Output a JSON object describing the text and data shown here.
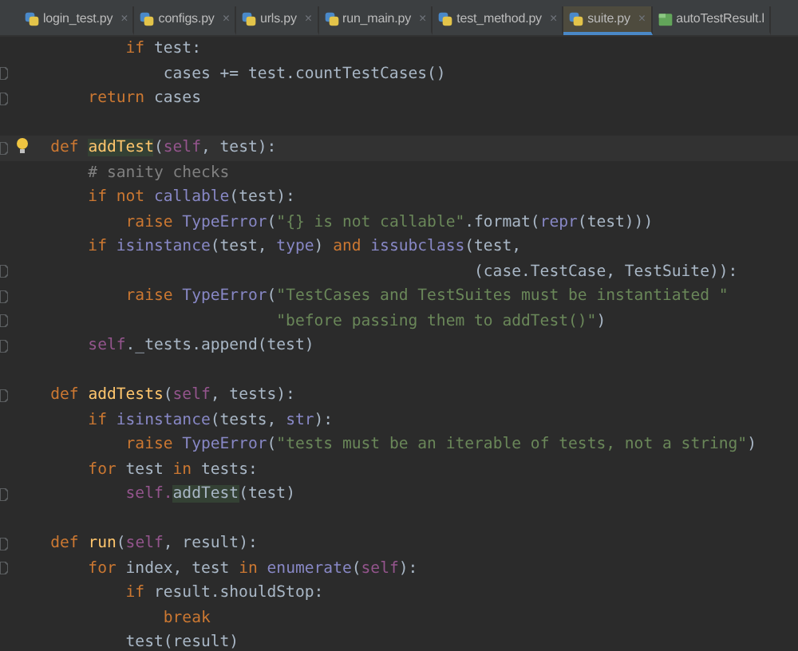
{
  "tabs": [
    {
      "label": "login_test.py",
      "kind": "python",
      "selected": false,
      "close": "×"
    },
    {
      "label": "configs.py",
      "kind": "python",
      "selected": false,
      "close": "×"
    },
    {
      "label": "urls.py",
      "kind": "python",
      "selected": false,
      "close": "×"
    },
    {
      "label": "run_main.py",
      "kind": "python",
      "selected": false,
      "close": "×"
    },
    {
      "label": "test_method.py",
      "kind": "python",
      "selected": false,
      "close": "×"
    },
    {
      "label": "suite.py",
      "kind": "python",
      "selected": true,
      "close": "×"
    },
    {
      "label": "autoTestResult.l",
      "kind": "html",
      "selected": false
    }
  ],
  "editor": {
    "lines": [
      {
        "fold": false,
        "current": false,
        "tokens": [
          {
            "kind": "kw",
            "text": "            if"
          },
          {
            "kind": "plain",
            "text": " test:"
          }
        ]
      },
      {
        "fold": true,
        "current": false,
        "tokens": [
          {
            "kind": "plain",
            "text": "                cases += test.countTestCases()"
          }
        ]
      },
      {
        "fold": true,
        "current": false,
        "tokens": [
          {
            "kind": "kw",
            "text": "        return"
          },
          {
            "kind": "plain",
            "text": " cases"
          }
        ]
      },
      {
        "fold": false,
        "current": false
      },
      {
        "fold": true,
        "current": true,
        "tokens": [
          {
            "kind": "kw",
            "text": "    def "
          },
          {
            "kind": "fnhl",
            "text": "addTest"
          },
          {
            "kind": "plain",
            "text": "("
          },
          {
            "kind": "self",
            "text": "self"
          },
          {
            "kind": "plain",
            "text": ", test):"
          }
        ]
      },
      {
        "fold": false,
        "current": false,
        "tokens": [
          {
            "kind": "cmt",
            "text": "        # sanity checks"
          }
        ]
      },
      {
        "fold": false,
        "current": false,
        "tokens": [
          {
            "kind": "kw",
            "text": "        if not "
          },
          {
            "kind": "builtin",
            "text": "callable"
          },
          {
            "kind": "plain",
            "text": "(test):"
          }
        ]
      },
      {
        "fold": false,
        "current": false,
        "tokens": [
          {
            "kind": "kw",
            "text": "            raise "
          },
          {
            "kind": "builtin",
            "text": "TypeError"
          },
          {
            "kind": "plain",
            "text": "("
          },
          {
            "kind": "str",
            "text": "\"{} is not callable\""
          },
          {
            "kind": "plain",
            "text": ".format("
          },
          {
            "kind": "builtin",
            "text": "repr"
          },
          {
            "kind": "plain",
            "text": "(test)))"
          }
        ]
      },
      {
        "fold": false,
        "current": false,
        "tokens": [
          {
            "kind": "kw",
            "text": "        if "
          },
          {
            "kind": "builtin",
            "text": "isinstance"
          },
          {
            "kind": "plain",
            "text": "(test, "
          },
          {
            "kind": "builtin",
            "text": "type"
          },
          {
            "kind": "plain",
            "text": ") "
          },
          {
            "kind": "kw",
            "text": "and "
          },
          {
            "kind": "builtin",
            "text": "issubclass"
          },
          {
            "kind": "plain",
            "text": "(test,"
          }
        ]
      },
      {
        "fold": true,
        "current": false,
        "tokens": [
          {
            "kind": "plain",
            "text": "                                                 (case.TestCase, TestSuite)):"
          }
        ]
      },
      {
        "fold": true,
        "current": false,
        "tokens": [
          {
            "kind": "kw",
            "text": "            raise "
          },
          {
            "kind": "builtin",
            "text": "TypeError"
          },
          {
            "kind": "plain",
            "text": "("
          },
          {
            "kind": "str",
            "text": "\"TestCases and TestSuites must be instantiated \""
          }
        ]
      },
      {
        "fold": true,
        "current": false,
        "tokens": [
          {
            "kind": "str",
            "text": "                            \"before passing them to addTest()\""
          },
          {
            "kind": "plain",
            "text": ")"
          }
        ]
      },
      {
        "fold": true,
        "current": false,
        "tokens": [
          {
            "kind": "self",
            "text": "        self"
          },
          {
            "kind": "plain",
            "text": "._tests.append(test)"
          }
        ]
      },
      {
        "fold": false,
        "current": false
      },
      {
        "fold": true,
        "current": false,
        "tokens": [
          {
            "kind": "kw",
            "text": "    def "
          },
          {
            "kind": "fn",
            "text": "addTests"
          },
          {
            "kind": "plain",
            "text": "("
          },
          {
            "kind": "self",
            "text": "self"
          },
          {
            "kind": "plain",
            "text": ", tests):"
          }
        ]
      },
      {
        "fold": false,
        "current": false,
        "tokens": [
          {
            "kind": "kw",
            "text": "        if "
          },
          {
            "kind": "builtin",
            "text": "isinstance"
          },
          {
            "kind": "plain",
            "text": "(tests, "
          },
          {
            "kind": "builtin",
            "text": "str"
          },
          {
            "kind": "plain",
            "text": "):"
          }
        ]
      },
      {
        "fold": false,
        "current": false,
        "tokens": [
          {
            "kind": "kw",
            "text": "            raise "
          },
          {
            "kind": "builtin",
            "text": "TypeError"
          },
          {
            "kind": "plain",
            "text": "("
          },
          {
            "kind": "str",
            "text": "\"tests must be an iterable of tests, not a string\""
          },
          {
            "kind": "plain",
            "text": ")"
          }
        ]
      },
      {
        "fold": false,
        "current": false,
        "tokens": [
          {
            "kind": "kw",
            "text": "        for"
          },
          {
            "kind": "plain",
            "text": " test "
          },
          {
            "kind": "kw",
            "text": "in"
          },
          {
            "kind": "plain",
            "text": " tests:"
          }
        ]
      },
      {
        "fold": true,
        "current": false,
        "tokens": [
          {
            "kind": "self",
            "text": "            self."
          },
          {
            "kind": "hl",
            "text": "addTest"
          },
          {
            "kind": "plain",
            "text": "(test)"
          }
        ]
      },
      {
        "fold": false,
        "current": false
      },
      {
        "fold": true,
        "current": false,
        "tokens": [
          {
            "kind": "kw",
            "text": "    def "
          },
          {
            "kind": "fn",
            "text": "run"
          },
          {
            "kind": "plain",
            "text": "("
          },
          {
            "kind": "self",
            "text": "self"
          },
          {
            "kind": "plain",
            "text": ", result):"
          }
        ]
      },
      {
        "fold": true,
        "current": false,
        "tokens": [
          {
            "kind": "kw",
            "text": "        for"
          },
          {
            "kind": "plain",
            "text": " index, test "
          },
          {
            "kind": "kw",
            "text": "in "
          },
          {
            "kind": "builtin",
            "text": "enumerate"
          },
          {
            "kind": "plain",
            "text": "("
          },
          {
            "kind": "self",
            "text": "self"
          },
          {
            "kind": "plain",
            "text": "):"
          }
        ]
      },
      {
        "fold": false,
        "current": false,
        "tokens": [
          {
            "kind": "kw",
            "text": "            if"
          },
          {
            "kind": "plain",
            "text": " result.shouldStop:"
          }
        ]
      },
      {
        "fold": false,
        "current": false,
        "tokens": [
          {
            "kind": "kw",
            "text": "                break"
          }
        ]
      },
      {
        "fold": false,
        "current": false,
        "tokens": [
          {
            "kind": "plain",
            "text": "            test(result)"
          }
        ]
      }
    ]
  }
}
